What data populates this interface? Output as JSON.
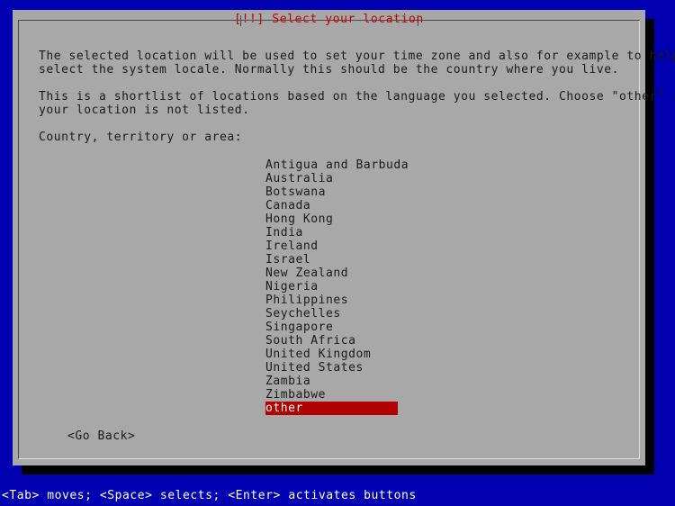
{
  "screen": {
    "background_color": "#0000b0",
    "panel_color": "#a8a8a8",
    "accent_red": "#b00000",
    "title_color": "#c00000",
    "text_color": "#1a1a1a"
  },
  "dialog": {
    "title": "[!!] Select your location",
    "paragraph1": "The selected location will be used to set your time zone and also for example to help\nselect the system locale. Normally this should be the country where you live.",
    "paragraph2": "This is a shortlist of locations based on the language you selected. Choose \"other\" if\nyour location is not listed.",
    "field_label": "Country, territory or area:",
    "list": {
      "items": [
        {
          "label": "Antigua and Barbuda",
          "selected": false
        },
        {
          "label": "Australia",
          "selected": false
        },
        {
          "label": "Botswana",
          "selected": false
        },
        {
          "label": "Canada",
          "selected": false
        },
        {
          "label": "Hong Kong",
          "selected": false
        },
        {
          "label": "India",
          "selected": false
        },
        {
          "label": "Ireland",
          "selected": false
        },
        {
          "label": "Israel",
          "selected": false
        },
        {
          "label": "New Zealand",
          "selected": false
        },
        {
          "label": "Nigeria",
          "selected": false
        },
        {
          "label": "Philippines",
          "selected": false
        },
        {
          "label": "Seychelles",
          "selected": false
        },
        {
          "label": "Singapore",
          "selected": false
        },
        {
          "label": "South Africa",
          "selected": false
        },
        {
          "label": "United Kingdom",
          "selected": false
        },
        {
          "label": "United States",
          "selected": false
        },
        {
          "label": "Zambia",
          "selected": false
        },
        {
          "label": "Zimbabwe",
          "selected": false
        },
        {
          "label": "other",
          "selected": true
        }
      ],
      "selected_value": "other"
    },
    "buttons": {
      "go_back": "<Go Back>"
    }
  },
  "statusbar": {
    "hint": "<Tab> moves; <Space> selects; <Enter> activates buttons"
  }
}
